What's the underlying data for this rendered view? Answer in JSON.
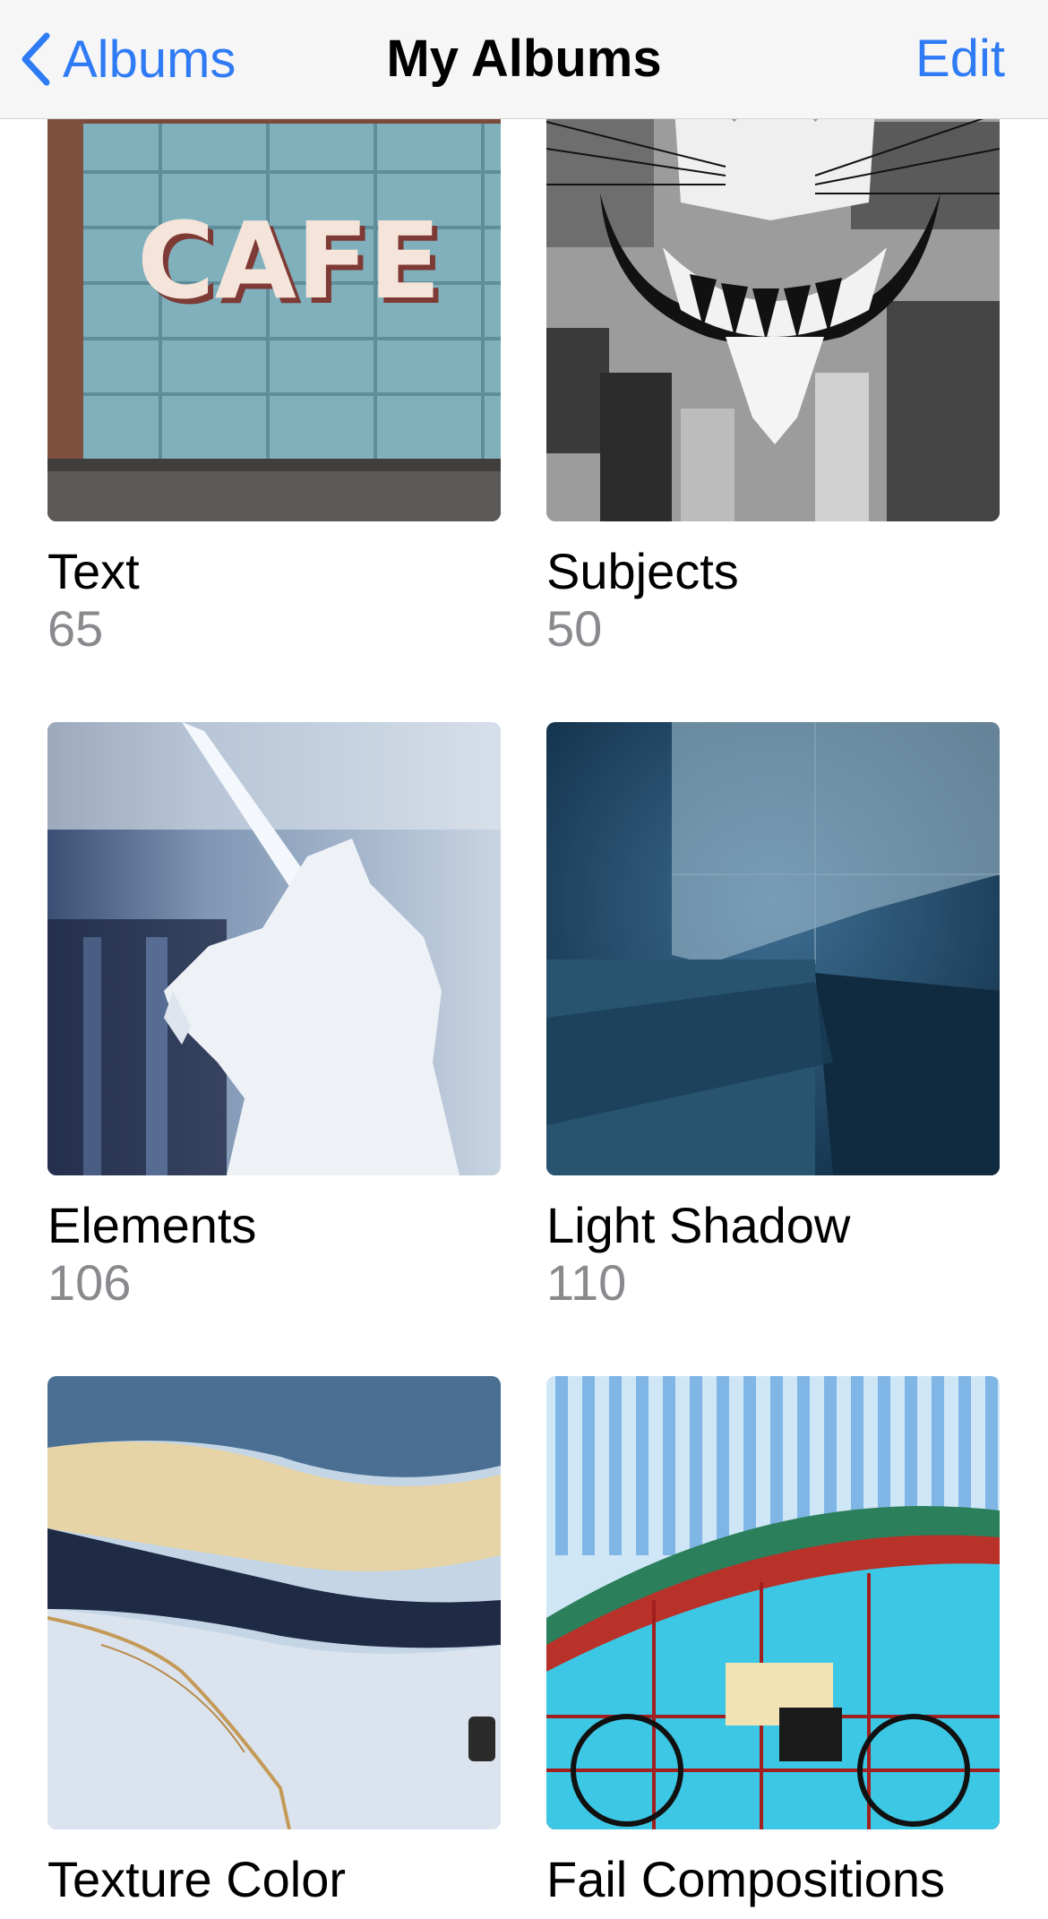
{
  "nav": {
    "back_label": "Albums",
    "title": "My Albums",
    "edit_label": "Edit",
    "accent_color": "#2f7bf5"
  },
  "albums": [
    {
      "title": "Text",
      "count": "65",
      "thumbnail": "cafe-garage-door"
    },
    {
      "title": "Subjects",
      "count": "50",
      "thumbnail": "cat-face-mural"
    },
    {
      "title": "Elements",
      "count": "106",
      "thumbnail": "unicorn-silhouette"
    },
    {
      "title": "Light Shadow",
      "count": "110",
      "thumbnail": "marble-shadow"
    },
    {
      "title": "Texture Color",
      "count": "",
      "thumbnail": "marble-texture"
    },
    {
      "title": "Fail Compositions",
      "count": "",
      "thumbnail": "motorcycle-mural"
    }
  ]
}
